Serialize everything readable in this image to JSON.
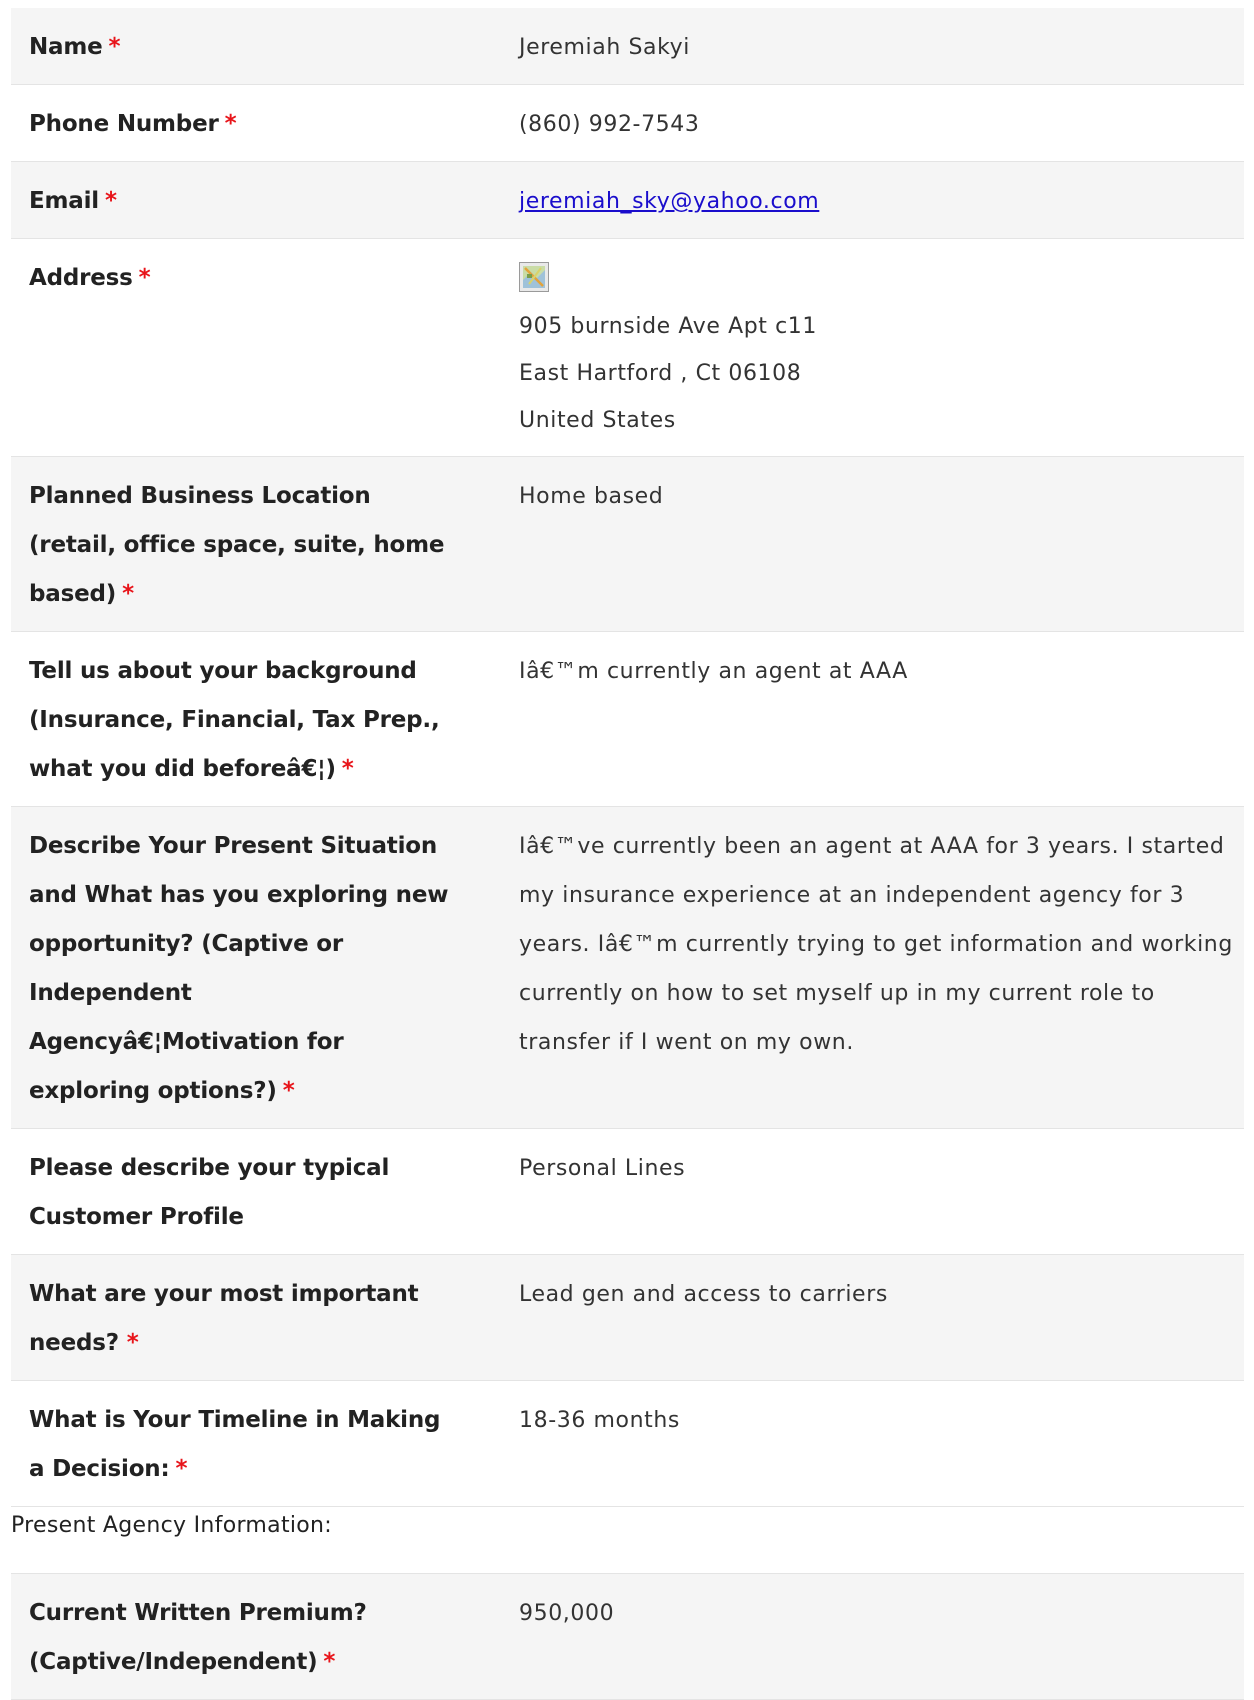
{
  "required_marker": "*",
  "fields": [
    {
      "label": "Name",
      "value": "Jeremiah Sakyi",
      "required": true
    },
    {
      "label": "Phone Number",
      "value": "(860) 992-7543",
      "required": true
    },
    {
      "label": "Email",
      "value": "jeremiah_sky@yahoo.com",
      "required": true
    },
    {
      "label": "Address",
      "required": true,
      "address": [
        "905 burnside Ave Apt c11",
        "East Hartford , Ct 06108",
        "United States"
      ]
    },
    {
      "label": "Planned Business Location (retail, office space, suite, home based)",
      "value": "Home based",
      "required": true
    },
    {
      "label": "Tell us about your background (Insurance, Financial, Tax Prep., what you did beforeâ€¦)",
      "value": "Iâ€™m currently an agent at AAA",
      "required": true
    },
    {
      "label": "Describe Your Present Situation and What has you exploring new opportunity? (Captive or Independent Agencyâ€¦Motivation for exploring options?)",
      "value": "Iâ€™ve currently been an agent at AAA for 3 years. I started my insurance experience at an independent agency for 3 years. Iâ€™m currently trying to get information and working currently on how to set myself up in my current role to transfer if I went on my own.",
      "required": true
    },
    {
      "label": "Please describe your typical Customer Profile",
      "value": "Personal Lines",
      "required": false
    },
    {
      "label": "What are your most important needs?",
      "value": "Lead gen and access to carriers",
      "required": true
    },
    {
      "label": "What is Your Timeline in Making a Decision:",
      "value": "18-36 months",
      "required": true
    }
  ],
  "section_heading": "Present Agency Information:",
  "agency_fields": [
    {
      "label": "Current Written Premium? (Captive/Independent)",
      "value": "950,000",
      "required": true
    }
  ]
}
